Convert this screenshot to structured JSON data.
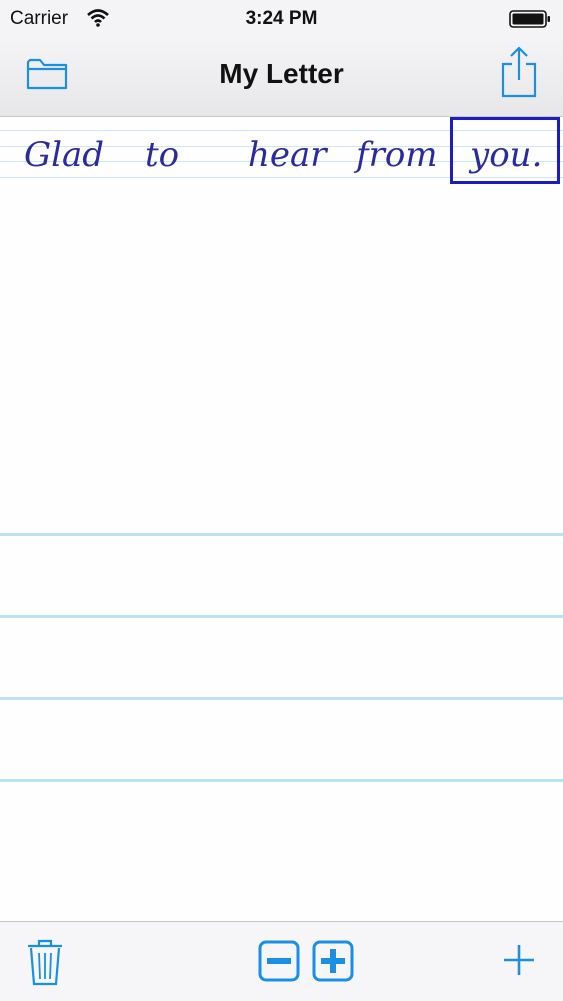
{
  "status_bar": {
    "carrier": "Carrier",
    "time": "3:24 PM",
    "wifi_icon": "wifi-icon",
    "battery_icon": "battery-icon"
  },
  "nav_bar": {
    "title": "My Letter",
    "left_icon": "folder-icon",
    "right_icon": "share-icon"
  },
  "document": {
    "handwritten_words": [
      "Glad",
      "to",
      "hear",
      "from",
      "you."
    ],
    "selected_word": "you.",
    "ink_color": "#2b2b9e",
    "selection_color": "#1c1cc0",
    "rule_color": "#bfe0f2"
  },
  "toolbar": {
    "icons": [
      "trash-icon",
      "zoom-out-icon",
      "zoom-in-icon",
      "add-icon"
    ],
    "accent": "#1a8fe3"
  }
}
